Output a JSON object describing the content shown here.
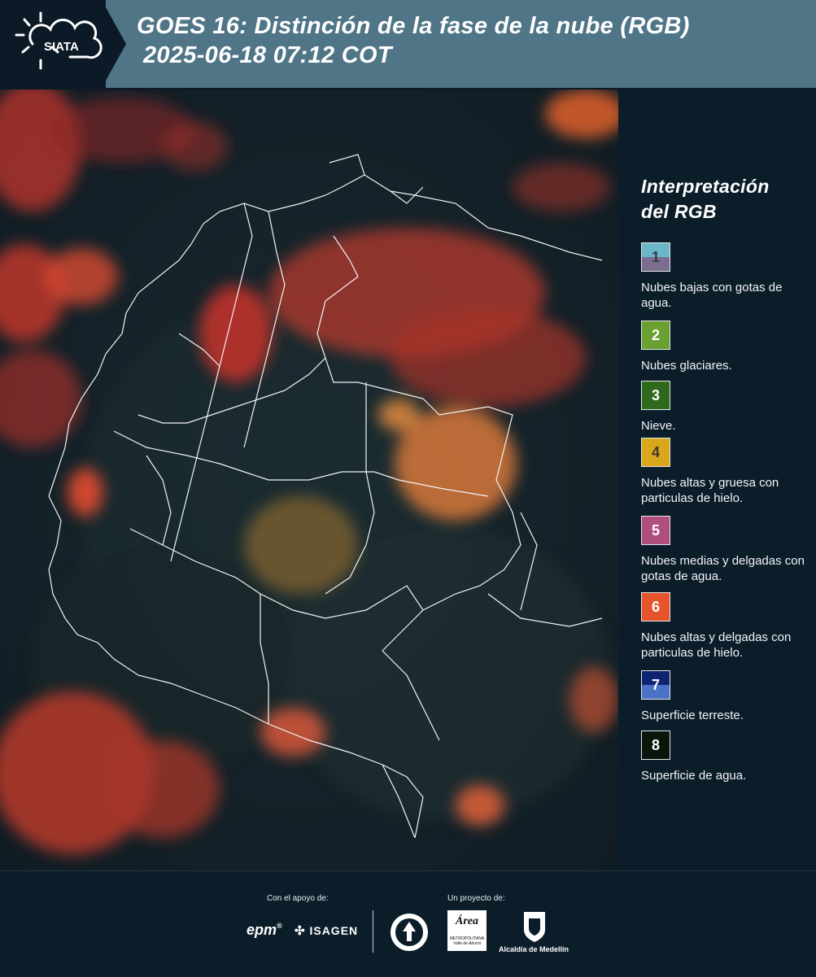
{
  "header": {
    "logo_text": "SIATA",
    "title_line1": "GOES 16: Distinción de la fase de la nube (RGB)",
    "title_line2": "2025-06-18 07:12 COT"
  },
  "legend": {
    "title_line1": "Interpretación",
    "title_line2": "del RGB",
    "items": [
      {
        "num": "1",
        "label": "Nubes bajas con gotas de agua.",
        "color_top": "#6ab7c9",
        "color_bottom": "#7b6d8e"
      },
      {
        "num": "2",
        "label": "Nubes glaciares.",
        "color_top": "#6aa030",
        "color_bottom": "#6aa030"
      },
      {
        "num": "3",
        "label": "Nieve.",
        "color_top": "#2f6a1c",
        "color_bottom": "#2f6a1c"
      },
      {
        "num": "4",
        "label": "Nubes altas y gruesa con particulas de hielo.",
        "color_top": "#d9a61c",
        "color_bottom": "#d9a61c"
      },
      {
        "num": "5",
        "label": "Nubes medias y delgadas con gotas de agua.",
        "color_top": "#b04e7e",
        "color_bottom": "#b04e7e"
      },
      {
        "num": "6",
        "label": "Nubes altas y delgadas con particulas de hielo.",
        "color_top": "#e6542c",
        "color_bottom": "#e6542c"
      },
      {
        "num": "7",
        "label": "Superficie terreste.",
        "color_top": "#0e2470",
        "color_bottom": "#4c72c8"
      },
      {
        "num": "8",
        "label": "Superficie de agua.",
        "color_top": "#0b150b",
        "color_bottom": "#0b150b"
      }
    ]
  },
  "footer": {
    "support_label": "Con el apoyo de:",
    "project_label": "Un proyecto de:",
    "sponsor_epm": "epm",
    "sponsor_isagen": "ISAGEN",
    "partner_area_line1": "Área",
    "partner_area_line2": "METROPOLITANA",
    "partner_area_line3": "Valle de Aburrá",
    "partner_alcaldia": "Alcaldía de Medellín"
  }
}
